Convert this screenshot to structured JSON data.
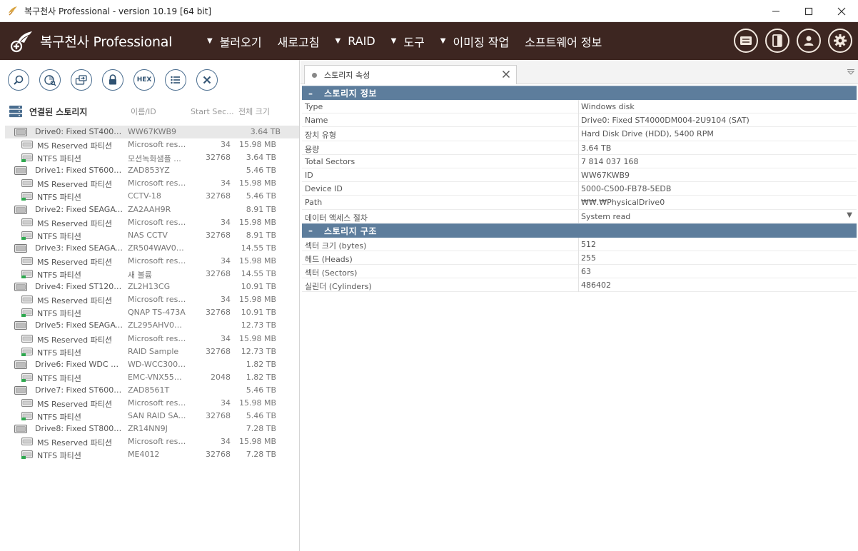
{
  "window": {
    "title": "복구천사 Professional - version 10.19 [64 bit]"
  },
  "menubar": {
    "brand": "복구천사 Professional",
    "items": [
      {
        "label": "불러오기",
        "caret": true
      },
      {
        "label": "새로고침",
        "caret": false
      },
      {
        "label": "RAID",
        "caret": true
      },
      {
        "label": "도구",
        "caret": true
      },
      {
        "label": "이미징 작업",
        "caret": true
      },
      {
        "label": "소프트웨어 정보",
        "caret": false
      }
    ],
    "icons": [
      "card-icon",
      "panel-icon",
      "user-icon",
      "gear-icon"
    ]
  },
  "toolbar": {
    "buttons": [
      "search-icon",
      "scan-icon",
      "copy-icon",
      "lock-icon",
      "hex-icon",
      "list-icon",
      "close-icon"
    ],
    "hex_label": "HEX"
  },
  "storage_list": {
    "title": "연결된 스토리지",
    "columns": {
      "label": "이름/ID",
      "start": "Start Sec...",
      "size": "전체 크기"
    },
    "drives": [
      {
        "name": "Drive0: Fixed ST4000D...",
        "id": "WW67KWB9",
        "size": "3.64 TB",
        "selected": true,
        "partitions": [
          {
            "name": "MS Reserved 파티션",
            "label": "Microsoft rese...",
            "start": "34",
            "size": "15.98 MB"
          },
          {
            "name": "NTFS 파티션",
            "label": "모션녹화샘플 ...",
            "start": "32768",
            "size": "3.64 TB"
          }
        ]
      },
      {
        "name": "Drive1: Fixed ST6000N...",
        "id": "ZAD853YZ",
        "size": "5.46 TB",
        "partitions": [
          {
            "name": "MS Reserved 파티션",
            "label": "Microsoft rese...",
            "start": "34",
            "size": "15.98 MB"
          },
          {
            "name": "NTFS 파티션",
            "label": "CCTV-18",
            "start": "32768",
            "size": "5.46 TB"
          }
        ]
      },
      {
        "name": "Drive2: Fixed SEAGATE ...",
        "id": "ZA2AAH9R",
        "size": "8.91 TB",
        "partitions": [
          {
            "name": "MS Reserved 파티션",
            "label": "Microsoft rese...",
            "start": "34",
            "size": "15.98 MB"
          },
          {
            "name": "NTFS 파티션",
            "label": "NAS CCTV",
            "start": "32768",
            "size": "8.91 TB"
          }
        ]
      },
      {
        "name": "Drive3: Fixed SEAGATE ...",
        "id": "ZR504WAV000...",
        "size": "14.55 TB",
        "partitions": [
          {
            "name": "MS Reserved 파티션",
            "label": "Microsoft rese...",
            "start": "34",
            "size": "15.98 MB"
          },
          {
            "name": "NTFS 파티션",
            "label": "새 볼륨",
            "start": "32768",
            "size": "14.55 TB"
          }
        ]
      },
      {
        "name": "Drive4: Fixed ST12000N...",
        "id": "ZL2H13CG",
        "size": "10.91 TB",
        "partitions": [
          {
            "name": "MS Reserved 파티션",
            "label": "Microsoft rese...",
            "start": "34",
            "size": "15.98 MB"
          },
          {
            "name": "NTFS 파티션",
            "label": "QNAP TS-473A",
            "start": "32768",
            "size": "10.91 TB"
          }
        ]
      },
      {
        "name": "Drive5: Fixed SEAGATE ...",
        "id": "ZL295AHV000...",
        "size": "12.73 TB",
        "partitions": [
          {
            "name": "MS Reserved 파티션",
            "label": "Microsoft rese...",
            "start": "34",
            "size": "15.98 MB"
          },
          {
            "name": "NTFS 파티션",
            "label": "RAID Sample",
            "start": "32768",
            "size": "12.73 TB"
          }
        ]
      },
      {
        "name": "Drive6: Fixed WDC WD...",
        "id": "WD-WCC3001...",
        "size": "1.82 TB",
        "partitions": [
          {
            "name": "NTFS 파티션",
            "label": "EMC-VNX550...",
            "start": "2048",
            "size": "1.82 TB"
          }
        ]
      },
      {
        "name": "Drive7: Fixed ST6000N...",
        "id": "ZAD8561T",
        "size": "5.46 TB",
        "partitions": [
          {
            "name": "MS Reserved 파티션",
            "label": "Microsoft rese...",
            "start": "34",
            "size": "15.98 MB"
          },
          {
            "name": "NTFS 파티션",
            "label": "SAN RAID SA...",
            "start": "32768",
            "size": "5.46 TB"
          }
        ]
      },
      {
        "name": "Drive8: Fixed ST8000D...",
        "id": "ZR14NN9J",
        "size": "7.28 TB",
        "partitions": [
          {
            "name": "MS Reserved 파티션",
            "label": "Microsoft rese...",
            "start": "34",
            "size": "15.98 MB"
          },
          {
            "name": "NTFS 파티션",
            "label": "ME4012",
            "start": "32768",
            "size": "7.28 TB"
          }
        ]
      }
    ]
  },
  "properties": {
    "tab_label": "스토리지 속성",
    "sections": [
      {
        "title": "스토리지 정보",
        "minus": "–",
        "rows": [
          {
            "key": "Type",
            "value": "Windows disk"
          },
          {
            "key": "Name",
            "value": "Drive0: Fixed ST4000DM004-2U9104 (SAT)"
          },
          {
            "key": "장치 유형",
            "value": "Hard Disk Drive (HDD), 5400 RPM"
          },
          {
            "key": "용량",
            "value": "3.64 TB"
          },
          {
            "key": "Total Sectors",
            "value": "7 814 037 168"
          },
          {
            "key": "ID",
            "value": "WW67KWB9"
          },
          {
            "key": "Device ID",
            "value": "5000-C500-FB78-5EDB"
          },
          {
            "key": "Path",
            "value": "₩₩.₩PhysicalDrive0"
          },
          {
            "key": "데이터 액세스 절차",
            "value": "System read",
            "dropdown": true
          }
        ]
      },
      {
        "title": "스토리지 구조",
        "minus": "–",
        "rows": [
          {
            "key": "섹터 크기 (bytes)",
            "value": "512"
          },
          {
            "key": "헤드 (Heads)",
            "value": "255"
          },
          {
            "key": "섹터 (Sectors)",
            "value": "63"
          },
          {
            "key": "실린더 (Cylinders)",
            "value": "486402"
          }
        ]
      }
    ]
  },
  "colors": {
    "menubar_bg": "#3d2621",
    "section_bg": "#5d7d9c",
    "tool_icon": "#2f5272"
  }
}
